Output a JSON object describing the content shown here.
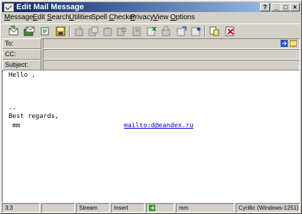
{
  "window": {
    "title": "Edit Mail Message"
  },
  "titlebar_buttons": [
    "?",
    "_",
    "□",
    "×"
  ],
  "menu": [
    {
      "label": "Message",
      "underline": "M"
    },
    {
      "label": "Edit",
      "underline": "E"
    },
    {
      "label": "Search",
      "underline": "S"
    },
    {
      "label": "Utilities",
      "underline": "U"
    },
    {
      "label": "Spell Checker",
      "underline": "C"
    },
    {
      "label": "Privacy",
      "underline": "P"
    },
    {
      "label": "View",
      "underline": "V"
    },
    {
      "label": "Options",
      "underline": "O"
    }
  ],
  "toolbar": {
    "icons": [
      "send-icon",
      "save-send-icon",
      "attach-icon",
      "save-icon",
      "cut-icon",
      "copy-icon",
      "paste-icon",
      "find-icon",
      "find-next-icon",
      "spell-check-icon",
      "encrypt-icon",
      "sign-icon",
      "address-book-icon",
      "insert-file-icon",
      "properties-icon",
      "cancel-icon"
    ]
  },
  "headers": {
    "to": {
      "label": "To:",
      "value": ""
    },
    "cc": {
      "label": "CC:",
      "value": ""
    },
    "subject": {
      "label": "Subject:",
      "value": ""
    }
  },
  "body": {
    "greeting": "Hello ,",
    "separator": "--",
    "regards": "Best regards,",
    "signature_name": " mm",
    "signature_link": "mailto:d@eandex.ru"
  },
  "status": {
    "position": "3:3",
    "format": "Stream",
    "mode": "Insert",
    "user": "mm",
    "encoding": "Cyrillic (Windows-1251)"
  },
  "colors": {
    "title_start": "#0a246a",
    "title_end": "#a6caf0",
    "link": "#0000cc",
    "face": "#d4d0c8"
  }
}
